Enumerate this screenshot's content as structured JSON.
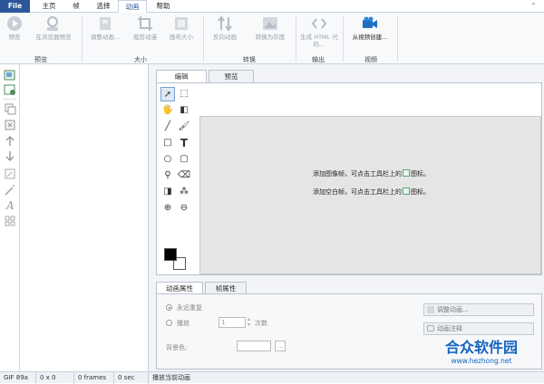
{
  "menu": {
    "file": "File",
    "tabs": [
      "主页",
      "帧",
      "选择",
      "动画",
      "帮助"
    ]
  },
  "ribbon": {
    "preview": "预览",
    "preview_browser": "在浏览器预览",
    "adjust_anim": "调整动画...",
    "crop": "裁剪动漫",
    "canvas_size": "画布大小",
    "reverse": "反向动画",
    "gray": "转换为灰度",
    "gen_html": "生成 HTML 代码...",
    "from_video": "从视频创建...",
    "groups": {
      "preview": "预览",
      "size": "大小",
      "convert": "转换",
      "output": "输出",
      "video": "视频"
    }
  },
  "editor": {
    "tab_edit": "编辑",
    "tab_preview": "预览",
    "hint1_pre": "添加图像帧，可点击工具栏上的",
    "hint1_post": "图标。",
    "hint2_pre": "添加空白帧，可点击工具栏上的",
    "hint2_post": "图标。",
    "text_tool": "T"
  },
  "props": {
    "tab_anim": "动画属性",
    "tab_frame": "帧属性",
    "repeat_forever": "永远重复",
    "play": "播放",
    "times_value": "1",
    "times_unit": "次数",
    "bg_color": "背景色:",
    "browse": "...",
    "adjust_btn": "调整动画...",
    "comment_btn": "动画注释"
  },
  "status": {
    "format": "GIF 89a",
    "dims": "0 x 0",
    "frames": "0 frames",
    "time": "0 sec",
    "action": "播放当前动画"
  },
  "watermark": {
    "title": "合众软件园",
    "url": "www.hezhong.net"
  },
  "colors": {
    "accent": "#2b579a",
    "canvas": "#e5e5e5",
    "watermark": "#1565c0"
  }
}
